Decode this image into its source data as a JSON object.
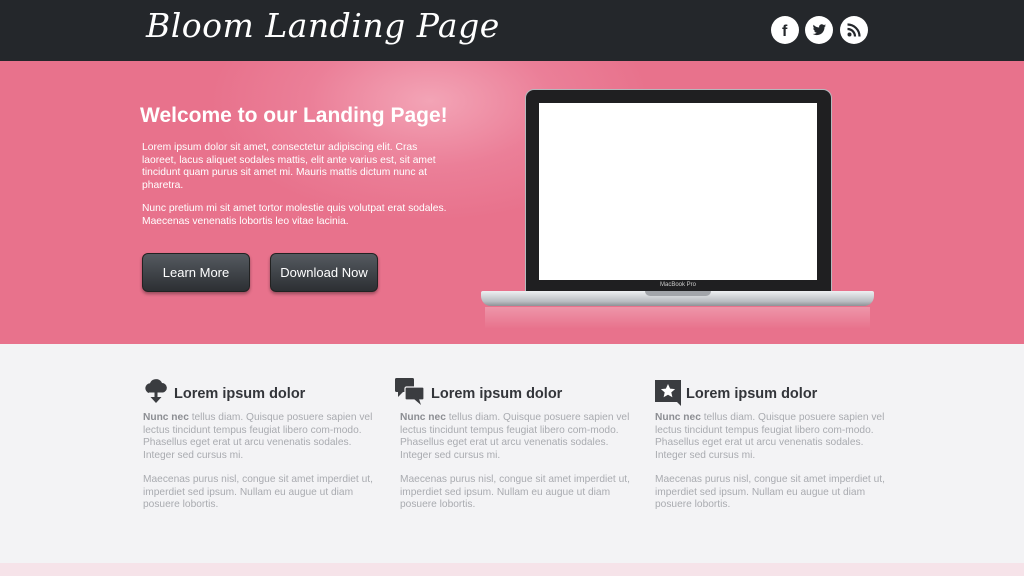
{
  "header": {
    "logo": "Bloom Landing Page",
    "social": [
      {
        "icon": "facebook-icon",
        "glyph": "f"
      },
      {
        "icon": "twitter-icon"
      },
      {
        "icon": "rss-icon"
      }
    ]
  },
  "hero": {
    "title": "Welcome to our Landing Page!",
    "paragraph1": "Lorem ipsum dolor sit amet, consectetur adipiscing elit. Cras laoreet, lacus aliquet sodales mattis, elit ante varius est, sit amet tincidunt quam purus sit amet mi. Mauris mattis dictum nunc at pharetra.",
    "paragraph2": "Nunc pretium mi sit amet tortor molestie quis volutpat erat sodales. Maecenas venenatis lobortis leo vitae lacinia.",
    "buttons": {
      "learn_more": "Learn More",
      "download_now": "Download Now"
    },
    "laptop_label": "MacBook Pro"
  },
  "features": [
    {
      "icon": "cloud-download-icon",
      "title": "Lorem ipsum dolor",
      "lead": "Nunc nec",
      "p1": " tellus diam. Quisque posuere sapien vel lectus tincidunt tempus feugiat libero com-modo. Phasellus eget erat ut arcu venenatis sodales. Integer sed cursus mi.",
      "p2": "Maecenas purus nisl, congue sit amet imperdiet ut, imperdiet sed ipsum. Nullam eu augue ut diam posuere lobortis."
    },
    {
      "icon": "chat-bubbles-icon",
      "title": "Lorem ipsum dolor",
      "lead": "Nunc nec",
      "p1": " tellus diam. Quisque posuere sapien vel lectus tincidunt tempus feugiat libero com-modo. Phasellus eget erat ut arcu venenatis sodales. Integer sed cursus mi.",
      "p2": "Maecenas purus nisl, congue sit amet imperdiet ut, imperdiet sed ipsum. Nullam eu augue ut diam posuere lobortis."
    },
    {
      "icon": "star-badge-icon",
      "title": "Lorem ipsum dolor",
      "lead": "Nunc nec",
      "p1": " tellus diam. Quisque posuere sapien vel lectus tincidunt tempus feugiat libero com-modo. Phasellus eget erat ut arcu venenatis sodales. Integer sed cursus mi.",
      "p2": "Maecenas purus nisl, congue sit amet imperdiet ut, imperdiet sed ipsum. Nullam eu augue ut diam posuere lobortis."
    }
  ],
  "colors": {
    "header_bg": "#24272b",
    "hero_pink": "#e8728c",
    "button_dark": "#2c2f33",
    "page_bg": "#f3f3f5"
  }
}
